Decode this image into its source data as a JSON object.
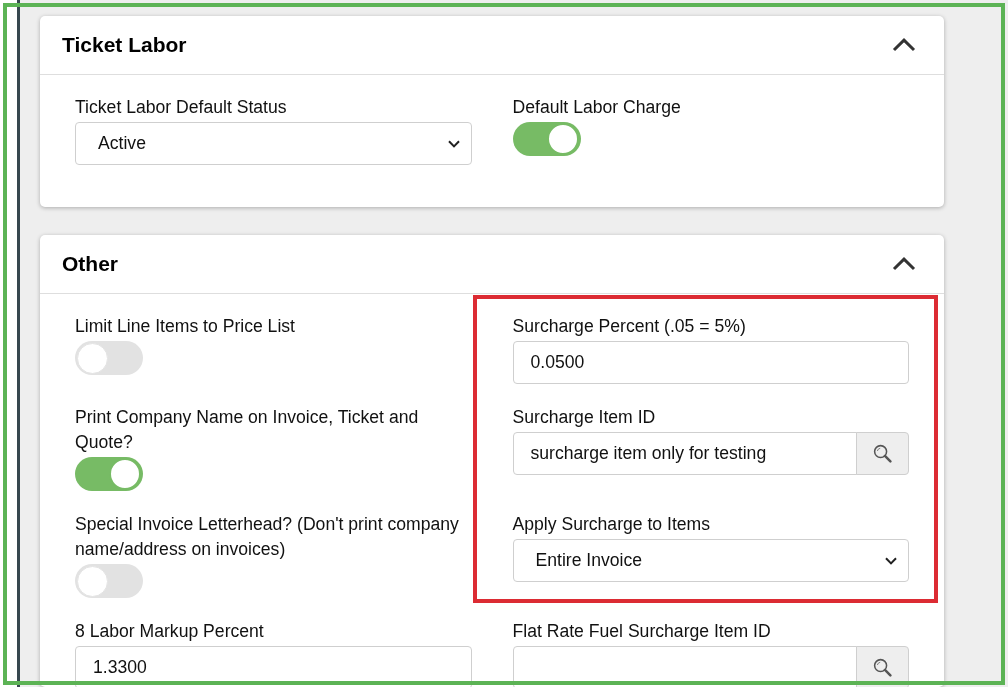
{
  "frame_highlighted": true,
  "sections": [
    {
      "title": "Ticket Labor",
      "expanded": true,
      "fields": [
        {
          "kind": "select",
          "label": "Ticket Labor Default Status",
          "value": "Active",
          "highlighted": false
        },
        {
          "kind": "toggle",
          "label": "Default Labor Charge",
          "on": true,
          "highlighted": false
        }
      ]
    },
    {
      "title": "Other",
      "expanded": true,
      "fields": [
        {
          "kind": "toggle",
          "label": "Limit Line Items to Price List",
          "on": false,
          "highlighted": false
        },
        {
          "kind": "text",
          "label": "Surcharge Percent (.05 = 5%)",
          "value": "0.0500",
          "highlighted": true
        },
        {
          "kind": "toggle",
          "label": "Print Company Name on Invoice, Ticket and Quote?",
          "on": true,
          "highlighted": false
        },
        {
          "kind": "lookup",
          "label": "Surcharge Item ID",
          "value": "surcharge item only for testing",
          "highlighted": true
        },
        {
          "kind": "toggle",
          "label": "Special Invoice Letterhead? (Don't print company name/address on invoices)",
          "on": false,
          "highlighted": false
        },
        {
          "kind": "select",
          "label": "Apply Surcharge to Items",
          "value": "Entire Invoice",
          "highlighted": true
        },
        {
          "kind": "text",
          "label": "8 Labor Markup Percent",
          "value": "1.3300",
          "highlighted": false
        },
        {
          "kind": "lookup",
          "label": "Flat Rate Fuel Surcharge Item ID",
          "highlighted": false
        }
      ]
    }
  ]
}
